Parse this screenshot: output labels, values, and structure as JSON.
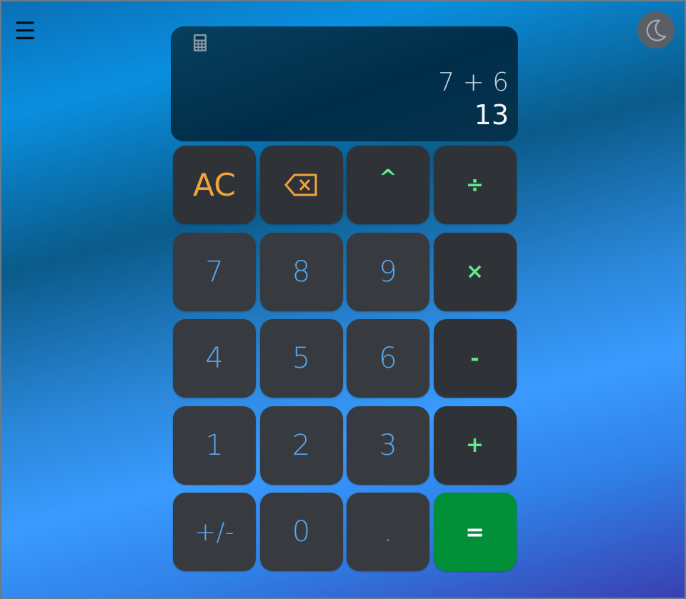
{
  "app": {
    "menu_glyph": "☰",
    "theme_icon": "moon-icon"
  },
  "display": {
    "icon": "calculator-icon",
    "expression": "7 + 6",
    "result": "13"
  },
  "keys": {
    "clear": "AC",
    "backspace_icon": "backspace-icon",
    "power": "^",
    "divide": "÷",
    "seven": "7",
    "eight": "8",
    "nine": "9",
    "multiply": "×",
    "four": "4",
    "five": "5",
    "six": "6",
    "minus": "-",
    "one": "1",
    "two": "2",
    "three": "3",
    "plus": "+",
    "sign": "+/-",
    "zero": "0",
    "decimal": ".",
    "equals": "="
  },
  "colors": {
    "number_text": "#5aa7ee",
    "control_text": "#f2a43a",
    "operator_text": "#5fe98a",
    "equals_bg": "#018f37",
    "key_bg": "#2f3236"
  }
}
